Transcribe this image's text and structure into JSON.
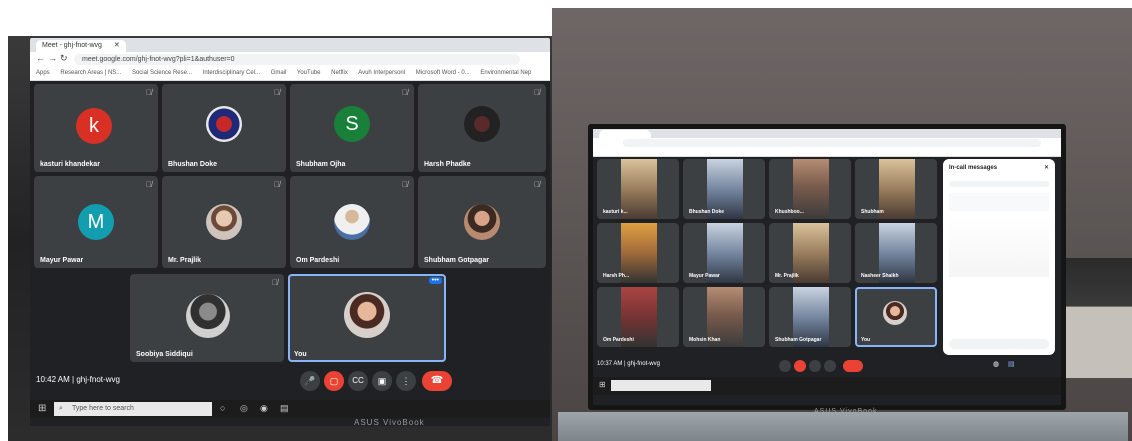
{
  "left": {
    "tab_title": "Meet - ghj-fnot-wvg",
    "url": "meet.google.com/ghj-fnot-wvg?pli=1&authuser=0",
    "bookmarks": [
      "Apps",
      "Research Areas | NS...",
      "Social Science Rese...",
      "Interdisciplinary Cel...",
      "Gmail",
      "YouTube",
      "Netflix",
      "Avuh Interpersonl",
      "Microsoft Word - 0...",
      "Environmental Nep"
    ],
    "tiles": [
      {
        "name": "kasturi khandekar",
        "initial": "k",
        "color": "#d93025"
      },
      {
        "name": "Bhushan Doke",
        "initial": "",
        "color": ""
      },
      {
        "name": "Shubham Ojha",
        "initial": "S",
        "color": "#188038"
      },
      {
        "name": "Harsh Phadke",
        "initial": "",
        "color": ""
      },
      {
        "name": "Mayur Pawar",
        "initial": "M",
        "color": "#129eaf"
      },
      {
        "name": "Mr. Prajlik",
        "initial": "",
        "color": ""
      },
      {
        "name": "Om Pardeshi",
        "initial": "",
        "color": ""
      },
      {
        "name": "Shubham Gotpagar",
        "initial": "",
        "color": ""
      },
      {
        "name": "Soobiya Siddiqui",
        "initial": "",
        "color": ""
      },
      {
        "name": "You",
        "initial": "",
        "color": ""
      }
    ],
    "time": "10:42 AM",
    "meeting_code": "ghj-fnot-wvg",
    "taskbar_search": "Type here to search",
    "brand": "ASUS VivoBook"
  },
  "right": {
    "tiles": [
      {
        "name": "kasturi k..."
      },
      {
        "name": "Bhushan Doke"
      },
      {
        "name": "Khushboo..."
      },
      {
        "name": "Shubham"
      },
      {
        "name": "Harsh Ph..."
      },
      {
        "name": "Mayur Pawar"
      },
      {
        "name": "Mr. Prajlik"
      },
      {
        "name": "Nasheer Shaikh"
      },
      {
        "name": "Om Pardeshi"
      },
      {
        "name": "Mohsin Khan"
      },
      {
        "name": "Shubham Gotpagar"
      },
      {
        "name": "You"
      }
    ],
    "chat_title": "In-call messages",
    "time": "10:37 AM",
    "meeting_code": "ghj-fnot-wvg",
    "brand": "ASUS VivoBook"
  },
  "colors": {
    "meet_bg": "#202124",
    "tile_bg": "#3c4043",
    "end_call": "#ea4335",
    "accent": "#1a73e8"
  },
  "icons": [
    "mic-icon",
    "camera-icon",
    "caption-icon",
    "present-icon",
    "more-icon",
    "end-call-icon",
    "chat-icon",
    "people-icon",
    "windows-icon",
    "search-icon"
  ]
}
